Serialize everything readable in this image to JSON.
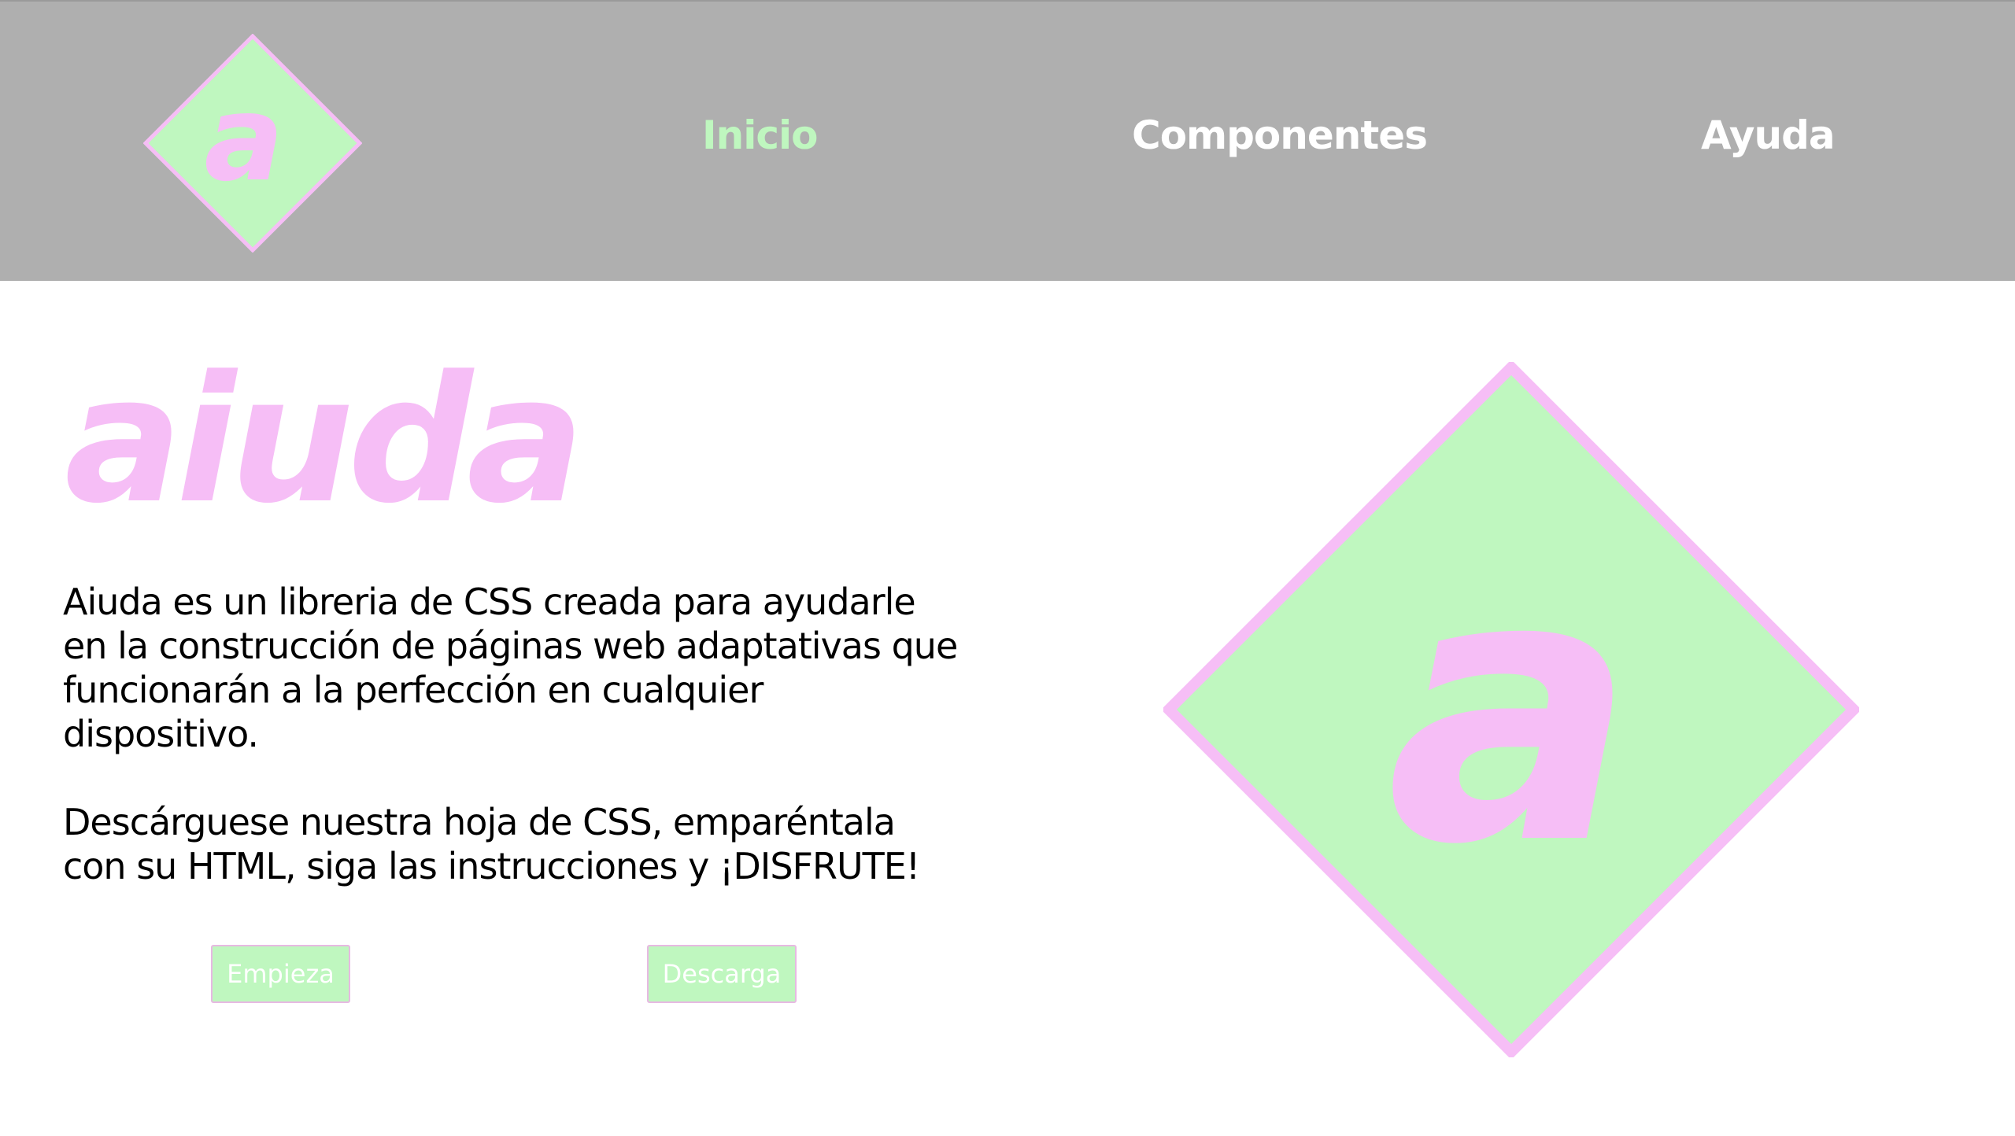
{
  "colors": {
    "header_bg": "#afafaf",
    "accent_pink": "#f6bef6",
    "accent_green": "#bff7bf",
    "nav_active": "#bff7bf",
    "nav_inactive": "#ffffff",
    "body_text": "#000000"
  },
  "header": {
    "logo": {
      "letter": "a",
      "icon": "logo-diamond-icon"
    },
    "nav": [
      {
        "label": "Inicio",
        "active": true
      },
      {
        "label": "Componentes",
        "active": false
      },
      {
        "label": "Ayuda",
        "active": false
      }
    ]
  },
  "hero": {
    "title": "aiuda",
    "paragraphs": [
      "Aiuda es un libreria de CSS creada para ayudarle en la construcción de páginas web adaptativas que funcionarán a la perfección en cualquier dispositivo.",
      "Descárguese nuestra hoja de CSS, emparéntala con su HTML, siga las instrucciones y ¡DISFRUTE!"
    ],
    "buttons": {
      "start_label": "Empieza",
      "download_label": "Descarga"
    },
    "logo": {
      "letter": "a",
      "icon": "logo-diamond-icon"
    }
  }
}
